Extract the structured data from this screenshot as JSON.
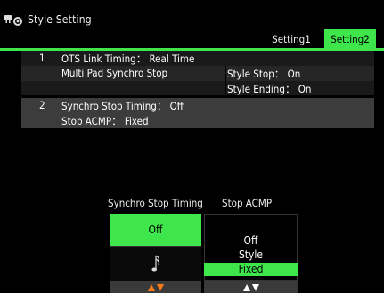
{
  "header": {
    "title": "Style Setting",
    "icon": "style-setting-icon"
  },
  "tabs": [
    {
      "label": "Setting1",
      "active": false
    },
    {
      "label": "Setting2",
      "active": true
    }
  ],
  "rows": {
    "r1": {
      "number": "1",
      "label": "OTS Link Timing： Real Time"
    },
    "r1b": {
      "label": "Multi Pad Synchro Stop",
      "value": "Style Stop： On"
    },
    "r1c": {
      "value": "Style Ending： On"
    },
    "r2": {
      "number": "2",
      "label": "Synchro Stop Timing： Off"
    },
    "r2b": {
      "label": "Stop ACMP： Fixed"
    }
  },
  "controls": {
    "synchro_stop_timing": {
      "header": "Synchro Stop Timing",
      "selected": "Off",
      "other_icon": "note-icon"
    },
    "stop_acmp": {
      "header": "Stop ACMP",
      "options": [
        "Off",
        "Style",
        "Fixed"
      ],
      "selected": "Fixed"
    }
  },
  "colors": {
    "accent": "#3ee64b",
    "arrow_orange": "#ff7a1a",
    "arrow_white": "#ffffff"
  }
}
